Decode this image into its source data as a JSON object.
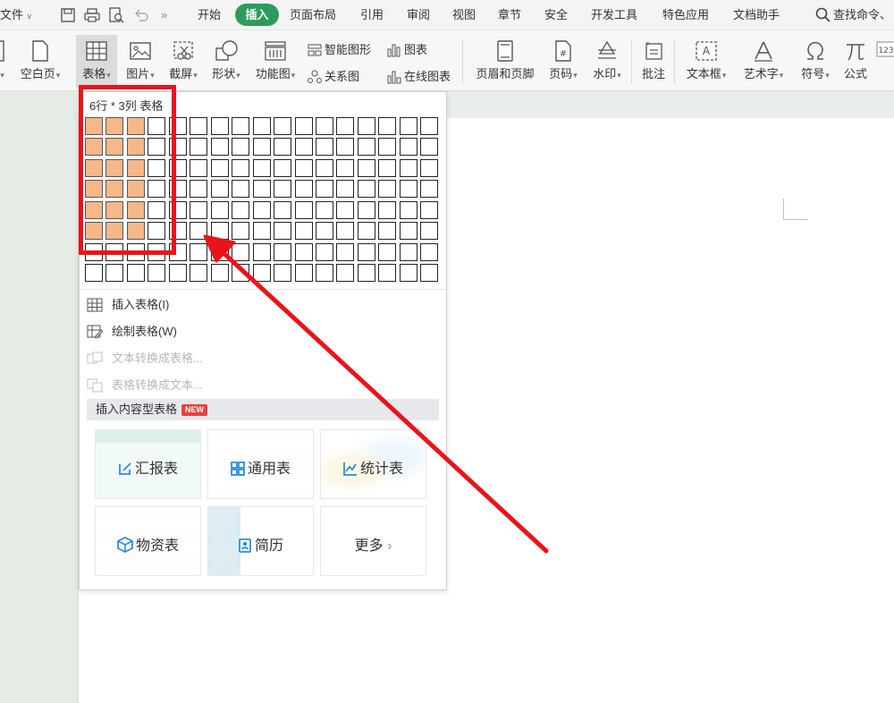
{
  "menubar": {
    "file": "文件",
    "tabs": [
      "开始",
      "插入",
      "页面布局",
      "引用",
      "审阅",
      "视图",
      "章节",
      "安全",
      "开发工具",
      "特色应用",
      "文档助手"
    ],
    "active_tab": "插入",
    "search": "查找命令、"
  },
  "ribbon": {
    "blank_page": "空白页",
    "table": "表格",
    "picture": "图片",
    "screenshot": "截屏",
    "shape": "形状",
    "function_chart": "功能图",
    "smart_art": "智能图形",
    "chart": "图表",
    "relation_chart": "关系图",
    "online_chart": "在线图表",
    "header_footer": "页眉和页脚",
    "page_number": "页码",
    "watermark": "水印",
    "comment": "批注",
    "textbox": "文本框",
    "word_art": "艺术字",
    "symbol": "符号",
    "formula": "公式"
  },
  "table_dropdown": {
    "grid_title": "6行 * 3列 表格",
    "grid_rows": 8,
    "grid_cols": 17,
    "selected_rows": 6,
    "selected_cols": 3,
    "insert_table": "插入表格(I)",
    "draw_table": "绘制表格(W)",
    "text_to_table": "文本转换成表格...",
    "table_to_text": "表格转换成文本...",
    "content_table_header": "插入内容型表格",
    "new_badge": "NEW",
    "templates": [
      "汇报表",
      "通用表",
      "统计表",
      "物资表",
      "简历",
      "更多"
    ]
  },
  "colors": {
    "accent": "#2e9b5c",
    "cell_selected": "#f6b789",
    "annotation": "#e8141b"
  }
}
